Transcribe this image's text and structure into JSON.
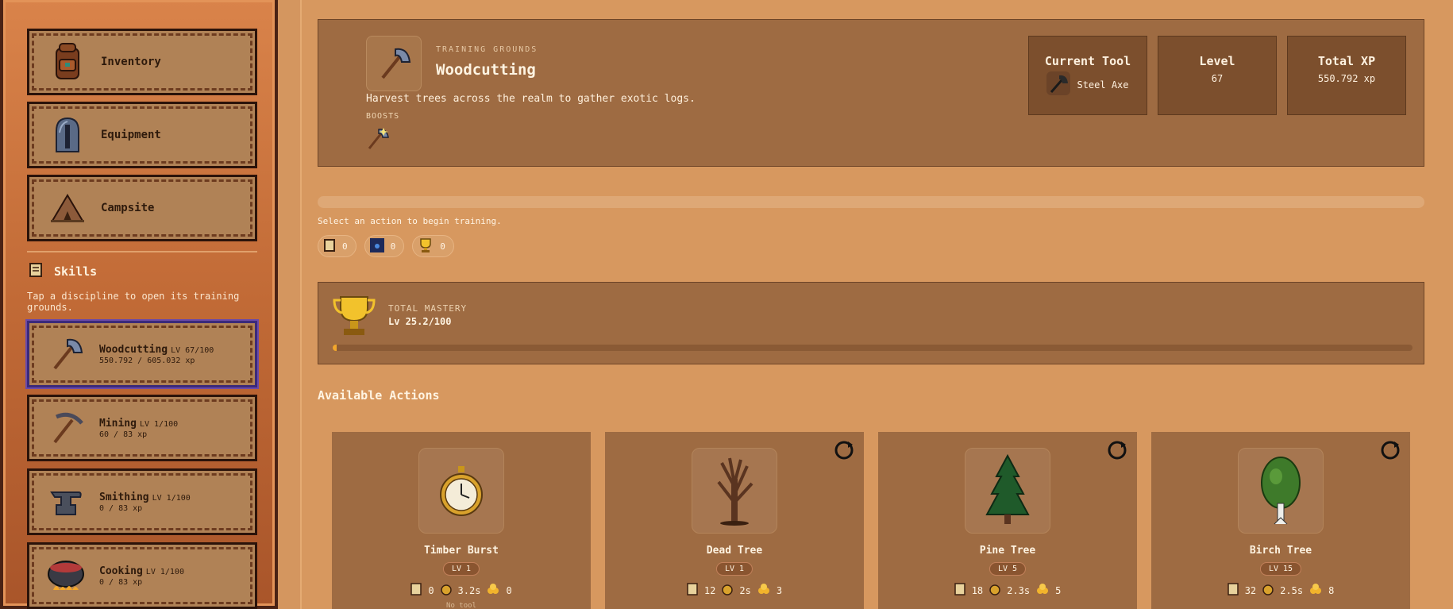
{
  "sidebar": {
    "nav": [
      {
        "label": "Inventory",
        "icon": "backpack-icon"
      },
      {
        "label": "Equipment",
        "icon": "helmet-icon"
      },
      {
        "label": "Campsite",
        "icon": "campsite-icon"
      }
    ],
    "skills_title": "Skills",
    "skills_subtitle": "Tap a discipline to open its training grounds.",
    "skills": [
      {
        "name": "Woodcutting",
        "level": "LV 67/100",
        "xp": "550.792 / 605.032 xp",
        "active": true
      },
      {
        "name": "Mining",
        "level": "LV 1/100",
        "xp": "60 / 83 xp"
      },
      {
        "name": "Smithing",
        "level": "LV 1/100",
        "xp": "0 / 83 xp"
      },
      {
        "name": "Cooking",
        "level": "LV 1/100",
        "xp": "0 / 83 xp"
      }
    ]
  },
  "header": {
    "eyebrow": "TRAINING GROUNDS",
    "title": "Woodcutting",
    "description": "Harvest trees across the realm to gather exotic logs.",
    "boosts_label": "BOOSTS",
    "stats": {
      "tool_label": "Current Tool",
      "tool_value": "Steel Axe",
      "level_label": "Level",
      "level_value": "67",
      "xp_label": "Total XP",
      "xp_value": "550.792 xp"
    }
  },
  "progress": {
    "text": "Select an action to begin training.",
    "pills": [
      {
        "icon": "scroll-icon",
        "value": "0"
      },
      {
        "icon": "gem-icon",
        "value": "0"
      },
      {
        "icon": "trophy-icon",
        "value": "0"
      }
    ]
  },
  "mastery": {
    "label": "TOTAL MASTERY",
    "value": "Lv 25.2/100",
    "fill_fraction": 0.002
  },
  "actions_title": "Available Actions",
  "actions": [
    {
      "name": "Timber Burst",
      "level": "LV 1",
      "xp": "0",
      "time": "3.2s",
      "coins": "0",
      "foot": "No tool"
    },
    {
      "name": "Dead Tree",
      "level": "LV 1",
      "xp": "12",
      "time": "2s",
      "coins": "3",
      "foot": ""
    },
    {
      "name": "Pine Tree",
      "level": "LV 5",
      "xp": "18",
      "time": "2.3s",
      "coins": "5",
      "foot": ""
    },
    {
      "name": "Birch Tree",
      "level": "LV 15",
      "xp": "32",
      "time": "2.5s",
      "coins": "8",
      "foot": ""
    }
  ],
  "colors": {
    "accent": "#f2a72c",
    "panel": "#9e6b42",
    "sidebar": "#c16a36"
  }
}
